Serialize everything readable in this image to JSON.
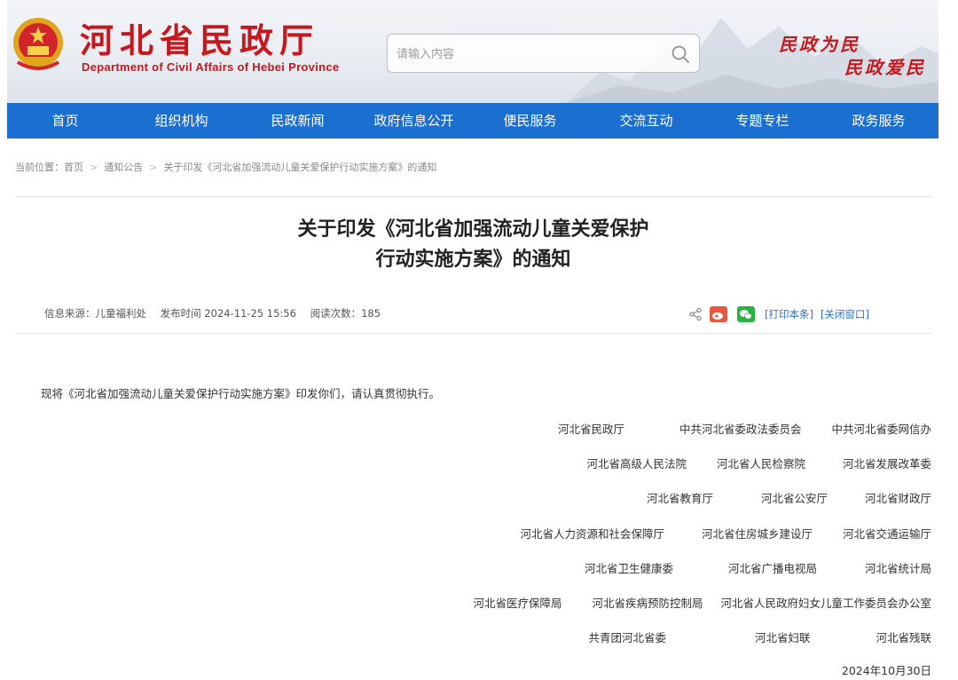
{
  "header": {
    "site_title": "河北省民政厅",
    "site_subtitle": "Department of Civil Affairs of Hebei Province",
    "search_placeholder": "请输入内容",
    "slogan_line1": "民政为民",
    "slogan_line2": "民政爱民",
    "colors": {
      "brand_red": "#c8161d",
      "nav_blue": "#1b6fd1"
    }
  },
  "nav": {
    "items": [
      "首页",
      "组织机构",
      "民政新闻",
      "政府信息公开",
      "便民服务",
      "交流互动",
      "专题专栏",
      "政务服务"
    ]
  },
  "breadcrumb": {
    "prefix": "当前位置：",
    "home": "首页",
    "section": "通知公告",
    "current": "关于印发《河北省加强流动儿童关爱保护行动实施方案》的通知",
    "separator": ">"
  },
  "article": {
    "title_line1": "关于印发《河北省加强流动儿童关爱保护",
    "title_line2": "行动实施方案》的通知",
    "source": "信息来源：儿童福利处",
    "publish_time": "发布时间 2024-11-25 15:56",
    "read_count": "阅读次数：185",
    "print_label": "[打印本条]",
    "close_label": "[关闭窗口]",
    "intro": "现将《河北省加强流动儿童关爱保护行动实施方案》印发你们，请认真贯彻执行。",
    "signatories": [
      [
        "河北省民政厅",
        "中共河北省委政法委员会",
        "中共河北省委网信办"
      ],
      [
        "河北省高级人民法院",
        "河北省人民检察院",
        "河北省发展改革委"
      ],
      [
        "河北省教育厅",
        "河北省公安厅",
        "河北省财政厅"
      ],
      [
        "河北省人力资源和社会保障厅",
        "河北省住房城乡建设厅",
        "河北省交通运输厅"
      ],
      [
        "河北省卫生健康委",
        "河北省广播电视局",
        "河北省统计局"
      ],
      [
        "河北省医疗保障局",
        "河北省疾病预防控制局",
        "河北省人民政府妇女儿童工作委员会办公室"
      ],
      [
        "共青团河北省委",
        "河北省妇联",
        "河北省残联"
      ]
    ],
    "date": "2024年10月30日"
  }
}
